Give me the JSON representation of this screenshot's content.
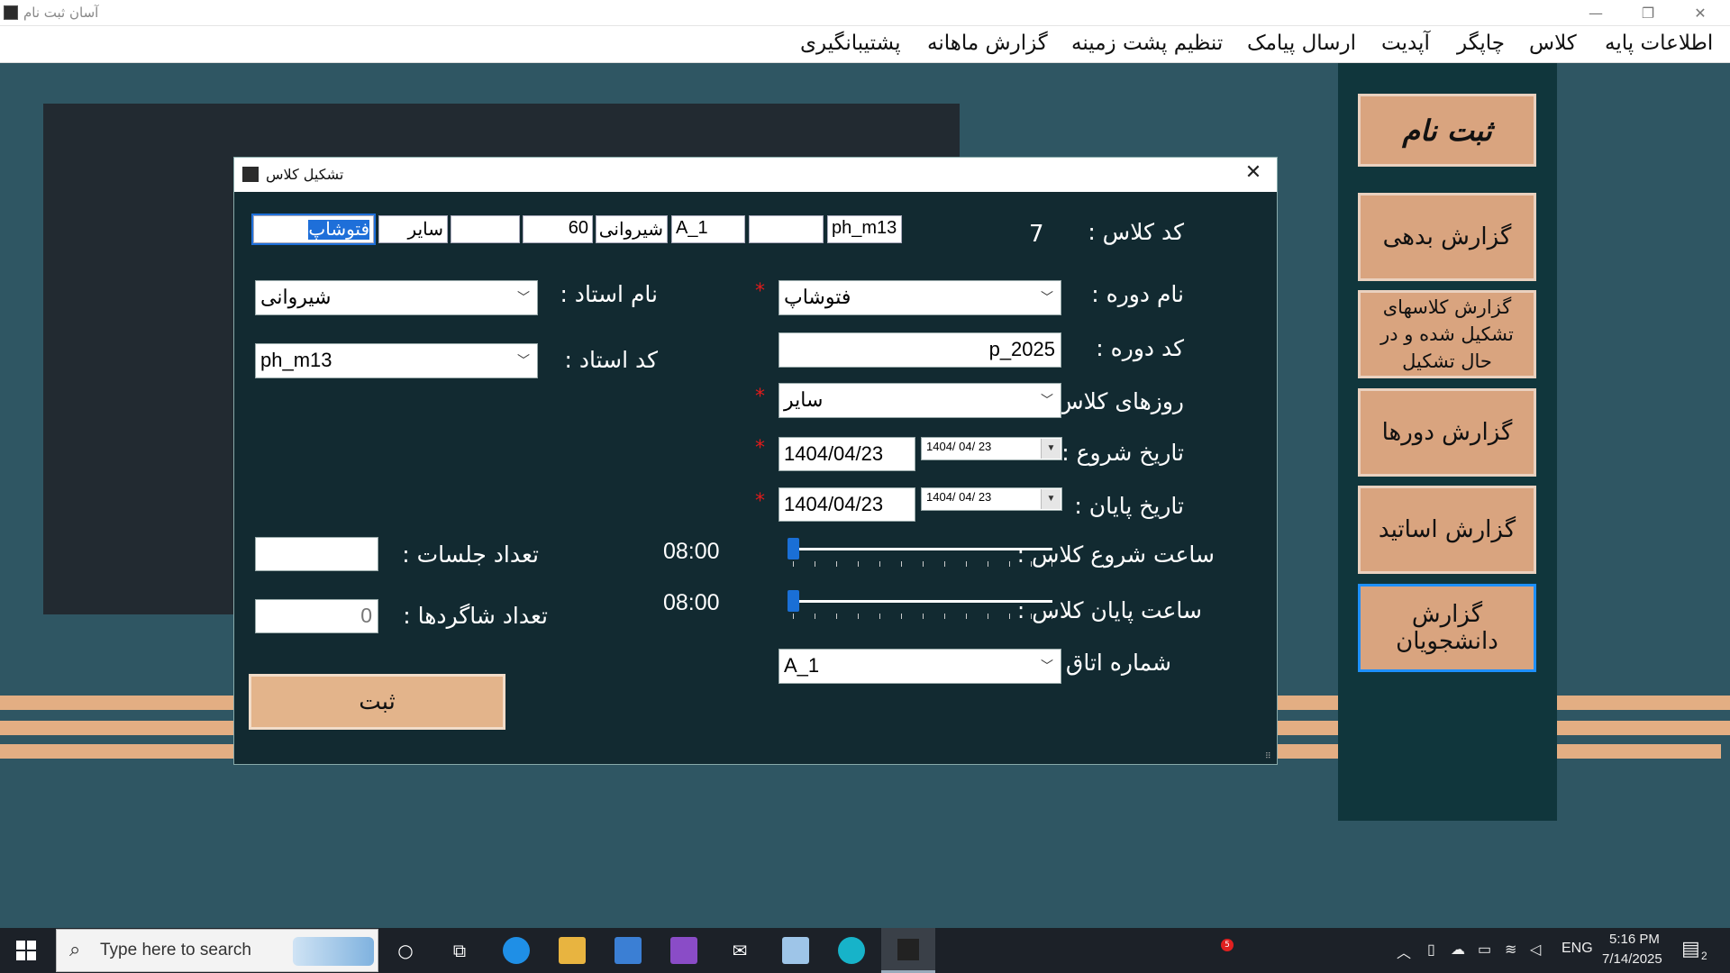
{
  "window": {
    "title": "آسان ثبت نام"
  },
  "menu": [
    "اطلاعات پایه",
    "کلاس",
    "چاپگر",
    "آپدیت",
    "ارسال پیامک",
    "تنظیم پشت زمینه",
    "گزارش ماهانه",
    "پشتیبانگیری"
  ],
  "sidebar": {
    "register": "ثبت نام",
    "debt_report": "گزارش بدهی",
    "classes_report": "گزارش کلاسهای تشکیل شده و در حال تشکیل",
    "courses_report": "گزارش دورها",
    "teachers_report": "گزارش اساتید",
    "students_report": "گزارش دانشجویان"
  },
  "dialog": {
    "title": "تشکیل کلاس",
    "close": "✕",
    "top_fields": [
      "فتوشاپ",
      "سایر",
      "",
      "60",
      "شیروانی",
      "A_1",
      "",
      "ph_m13"
    ],
    "class_code_label": "کد کلاس :",
    "class_code_value": "7",
    "course_name_label": "نام دوره :",
    "course_name_value": "فتوشاپ",
    "course_code_label": "کد دوره :",
    "course_code_value": "p_2025",
    "class_days_label": "روزهای کلاس :",
    "class_days_value": "سایر",
    "start_date_label": "تاریخ شروع :",
    "start_date_value": "1404/04/23",
    "start_date_picker": "1404/ 04/ 23",
    "end_date_label": "تاریخ پایان :",
    "end_date_value": "1404/04/23",
    "end_date_picker": "1404/ 04/ 23",
    "start_time_label": "ساعت شروع  کلاس :",
    "start_time_value": "08:00",
    "end_time_label": "ساعت پایان  کلاس :",
    "end_time_value": "08:00",
    "room_label": "شماره اتاق :",
    "room_value": "A_1",
    "teacher_name_label": "نام استاد :",
    "teacher_name_value": "شیروانی",
    "teacher_code_label": "کد استاد :",
    "teacher_code_value": "ph_m13",
    "sessions_label": "تعداد جلسات :",
    "sessions_value": "",
    "students_label": "تعداد شاگردها :",
    "students_value": "0",
    "required_mark": "*",
    "submit": "ثبت"
  },
  "taskbar": {
    "search_placeholder": "Type here to search",
    "lang": "ENG",
    "time": "5:16 PM",
    "date": "7/14/2025",
    "badge": "5",
    "notif_count": "2"
  }
}
